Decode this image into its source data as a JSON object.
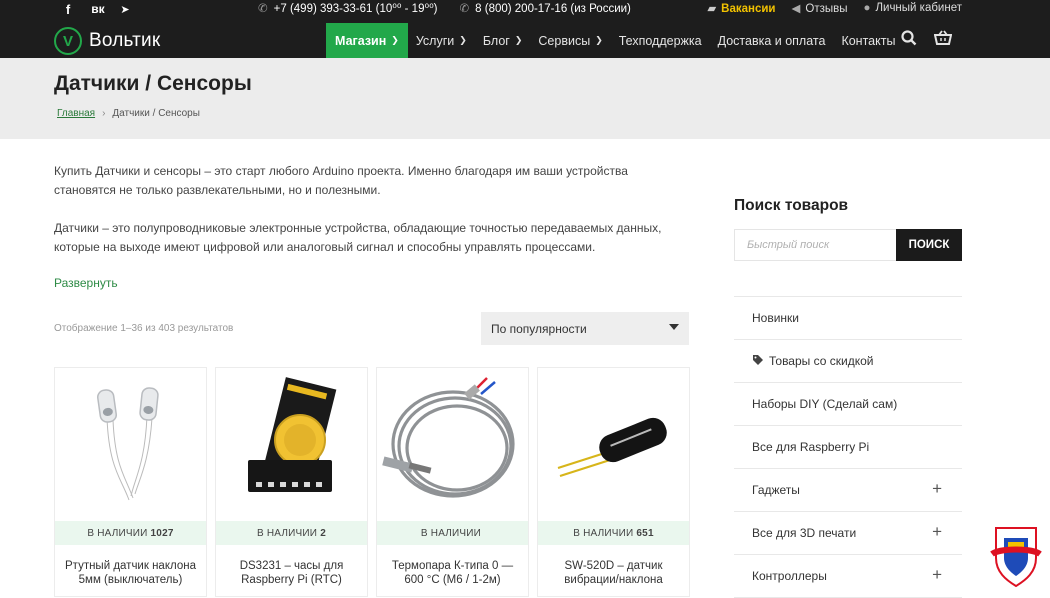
{
  "topbar": {
    "social": [
      {
        "icon": "facebook-icon",
        "glyph": "f"
      },
      {
        "icon": "vk-icon",
        "glyph": "вк"
      },
      {
        "icon": "telegram-icon",
        "glyph": "➤"
      }
    ],
    "phone1": "+7 (499) 393-33-61 (10⁰⁰ - 19⁰⁰)",
    "phone2": "8 (800) 200-17-16 (из России)",
    "vacancies": "Вакансии",
    "reviews": "Отзывы",
    "account": "Личный кабинет"
  },
  "brand": {
    "name": "Вольтик",
    "logo_letter": "V",
    "accent": "#22a84a"
  },
  "nav": [
    {
      "label": "Магазин",
      "dropdown": true,
      "active": true
    },
    {
      "label": "Услуги",
      "dropdown": true
    },
    {
      "label": "Блог",
      "dropdown": true
    },
    {
      "label": "Сервисы",
      "dropdown": true
    },
    {
      "label": "Техподдержка",
      "dropdown": false
    },
    {
      "label": "Доставка и оплата",
      "dropdown": false
    },
    {
      "label": "Контакты",
      "dropdown": false
    }
  ],
  "page": {
    "title": "Датчики / Сенсоры",
    "breadcrumb_home": "Главная",
    "breadcrumb_current": "Датчики / Сенсоры",
    "intro_p1": "Купить Датчики и сенсоры – это старт любого Arduino проекта. Именно благодаря им ваши устройства становятся не только развлекательными, но и полезными.",
    "intro_p2": "Датчики – это полупроводниковые электронные устройства, обладающие точностью передаваемых данных, которые на выходе имеют цифровой или аналоговый сигнал и способны управлять процессами.",
    "expand_label": "Развернуть",
    "result_count": "Отображение 1–36 из 403 результатов",
    "sort_value": "По популярности"
  },
  "products": [
    {
      "stock_label": "В НАЛИЧИИ",
      "stock_qty": "1027",
      "name": "Ртутный датчик наклона 5мм (выключатель)"
    },
    {
      "stock_label": "В НАЛИЧИИ",
      "stock_qty": "2",
      "name": "DS3231 – часы для Raspberry Pi (RTC)"
    },
    {
      "stock_label": "В НАЛИЧИИ",
      "stock_qty": "",
      "name": "Термопара К-типа 0 — 600 °C (М6 / 1-2м)"
    },
    {
      "stock_label": "В НАЛИЧИИ",
      "stock_qty": "651",
      "name": "SW-520D – датчик вибрации/наклона"
    }
  ],
  "sidebar": {
    "search_title": "Поиск товаров",
    "search_placeholder": "Быстрый поиск",
    "search_button": "ПОИСК",
    "categories": [
      {
        "label": "Новинки",
        "expandable": false
      },
      {
        "label": "Товары со скидкой",
        "expandable": false,
        "icon": "tag-icon"
      },
      {
        "label": "Наборы DIY (Сделай сам)",
        "expandable": false
      },
      {
        "label": "Все для Raspberry Pi",
        "expandable": false
      },
      {
        "label": "Гаджеты",
        "expandable": true
      },
      {
        "label": "Все для 3D печати",
        "expandable": true
      },
      {
        "label": "Контроллеры",
        "expandable": true
      }
    ]
  }
}
